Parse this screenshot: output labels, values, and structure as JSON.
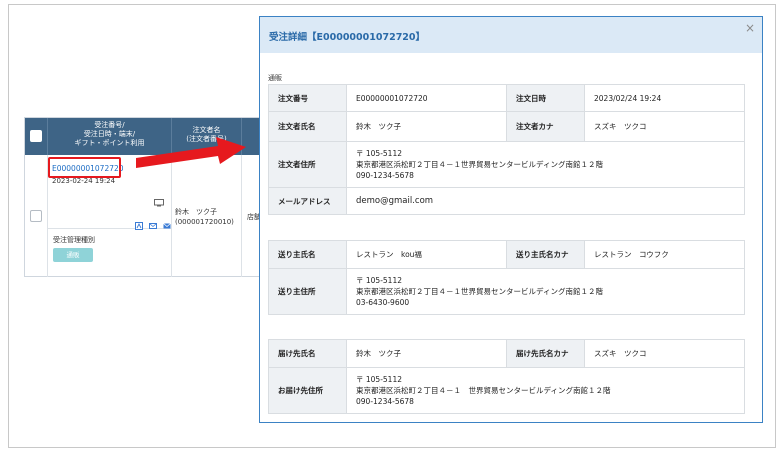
{
  "order_list": {
    "header_col1": [
      "受注番号/",
      "受注日時・端末/",
      "ギフト・ポイント利用"
    ],
    "header_col2": [
      "注文者名",
      "(注文者番号)"
    ],
    "order_number": "E00000001072720",
    "order_datetime": "2023-02-24 19:24",
    "mgmt_type_label": "受注管理種別",
    "mgmt_type_value": "通販",
    "orderer_name": "鈴木　ツク子",
    "orderer_number": "(000001720010)",
    "store_partial": "店舗"
  },
  "modal": {
    "title": "受注詳細【E00000001072720】",
    "close_glyph": "×",
    "section_tag": "通販",
    "order_info": {
      "order_no_label": "注文番号",
      "order_no_value": "E00000001072720",
      "order_date_label": "注文日時",
      "order_date_value": "2023/02/24 19:24",
      "name_label": "注文者氏名",
      "name_value": "鈴木　ツク子",
      "kana_label": "注文者カナ",
      "kana_value": "スズキ　ツクコ",
      "address_label": "注文者住所",
      "address_lines": [
        "〒 105-5112",
        "東京都港区浜松町２丁目４－１世界貿易センタービルディング南館１２階",
        "090-1234-5678"
      ],
      "email_label": "メールアドレス",
      "email_value": "demo@gmail.com"
    },
    "sender_info": {
      "name_label": "送り主氏名",
      "name_value": "レストラン　kou福",
      "kana_label": "送り主氏名カナ",
      "kana_value": "レストラン　コウフク",
      "address_label": "送り主住所",
      "address_lines": [
        "〒 105-5112",
        "東京都港区浜松町２丁目４－１世界貿易センタービルディング南館１２階",
        "03-6430-9600"
      ]
    },
    "delivery_info": {
      "name_label": "届け先氏名",
      "name_value": "鈴木　ツク子",
      "kana_label": "届け先氏名カナ",
      "kana_value": "スズキ　ツクコ",
      "address_label": "お届け先住所",
      "address_lines": [
        "〒 105-5112",
        "東京都港区浜松町２丁目４－１　世界貿易センタービルディング南館１２階",
        "090-1234-5678"
      ]
    }
  },
  "colors": {
    "header_navy": "#3e6486",
    "link_blue": "#1a6bc4",
    "highlight_red": "#e6191e",
    "modal_border": "#3b82c4",
    "modal_header_bg": "#dbe9f6",
    "badge_teal": "#8fd3d8"
  }
}
